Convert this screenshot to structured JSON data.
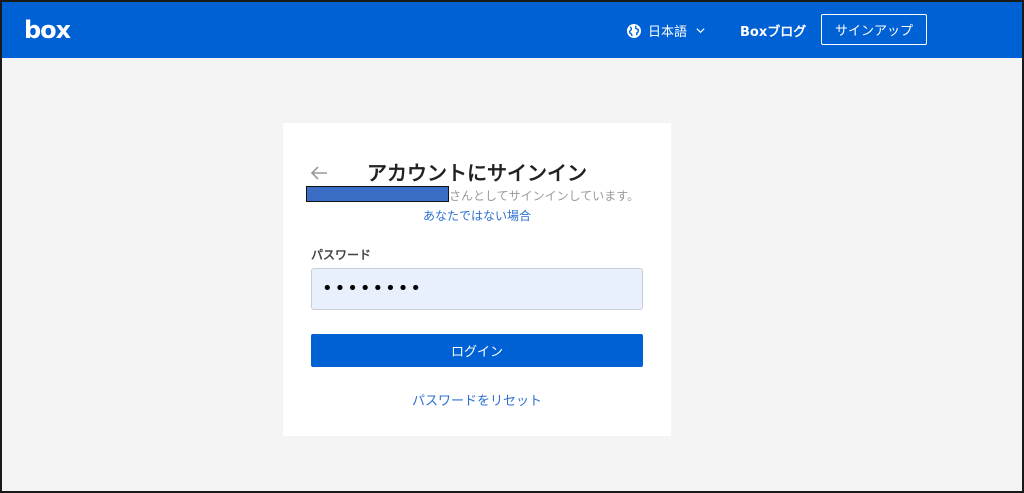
{
  "header": {
    "logo_text": "box",
    "language_label": "日本語",
    "blog_label": "Boxブログ",
    "signup_label": "サインアップ",
    "icons": {
      "language": "globe-icon",
      "dropdown": "chevron-down-icon"
    },
    "colors": {
      "bar": "#0061d5",
      "text": "#ffffff"
    }
  },
  "card": {
    "title": "アカウントにサインイン",
    "signed_in_as_suffix": "さんとしてサインインしています。",
    "not_you_link": "あなたではない場合",
    "password_label": "パスワード",
    "password_value": "••••••••",
    "login_button": "ログイン",
    "reset_link": "パスワードをリセット",
    "back_icon": "arrow-left-icon",
    "colors": {
      "button": "#0061d5",
      "link": "#2d6fd1",
      "input_bg": "#e8f0fe"
    }
  }
}
